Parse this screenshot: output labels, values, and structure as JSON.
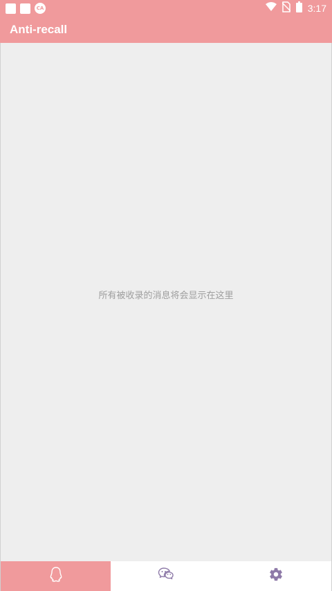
{
  "status_bar": {
    "time": "3:17",
    "notification_icons": [
      "square-icon",
      "square-icon",
      "ca-app-icon"
    ],
    "ca_badge_text": "CA",
    "system_icons": [
      "wifi-icon",
      "no-sim-icon",
      "battery-icon"
    ]
  },
  "app_bar": {
    "title": "Anti-recall"
  },
  "main": {
    "empty_message": "所有被收录的消息将会显示在这里"
  },
  "bottom_nav": {
    "tabs": [
      {
        "icon": "qq-penguin-icon",
        "active": true
      },
      {
        "icon": "wechat-icon",
        "active": false
      },
      {
        "icon": "settings-gear-icon",
        "active": false
      }
    ]
  },
  "colors": {
    "accent": "#f09a9c",
    "background": "#eeeeee",
    "inactive_icon": "#8e7aa8",
    "empty_text": "#9e9e9e"
  }
}
